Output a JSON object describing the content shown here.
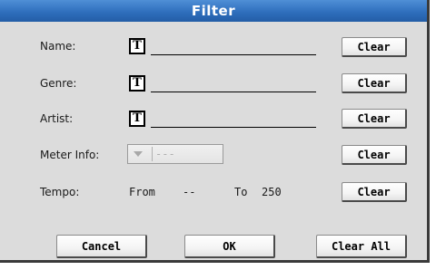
{
  "dialog": {
    "title": "Filter"
  },
  "fields": {
    "name_label": "Name:",
    "genre_label": "Genre:",
    "artist_label": "Artist:",
    "meter_label": "Meter Info:",
    "tempo_label": "Tempo:",
    "text_icon_glyph": "T",
    "meter_value": "---",
    "tempo_from_label": "From",
    "tempo_from_value": "--",
    "tempo_to_label": "To",
    "tempo_to_value": "250"
  },
  "buttons": {
    "clear": "Clear",
    "cancel": "Cancel",
    "ok": "OK",
    "clear_all": "Clear All"
  },
  "colors": {
    "title_bar": "#2f6fbd",
    "dialog_bg": "#dcdcdc"
  }
}
